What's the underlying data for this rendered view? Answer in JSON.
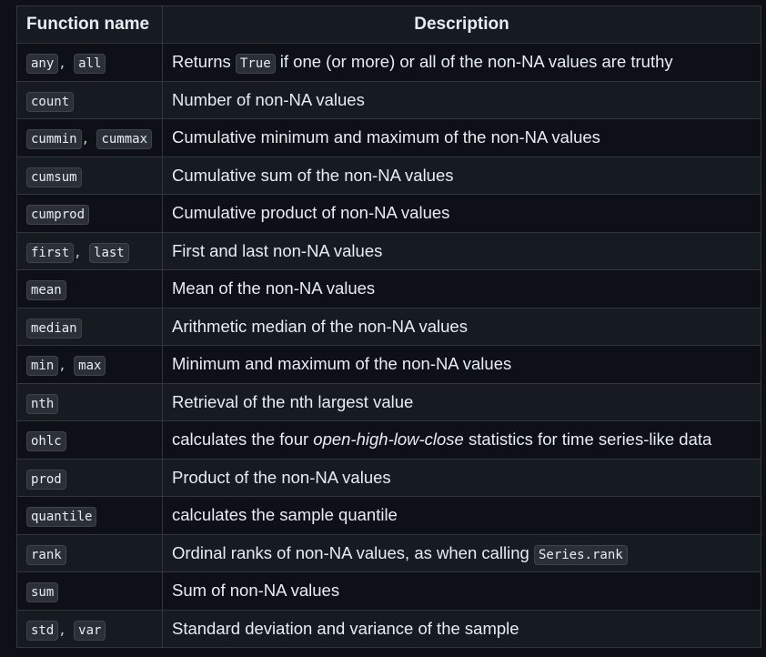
{
  "headers": [
    "Function name",
    "Description"
  ],
  "rows": [
    {
      "names": [
        "any",
        "all"
      ],
      "desc": [
        {
          "t": "text",
          "v": "Returns "
        },
        {
          "t": "code",
          "v": "True"
        },
        {
          "t": "text",
          "v": " if one (or more) or all of the non-NA values are truthy"
        }
      ]
    },
    {
      "names": [
        "count"
      ],
      "desc": [
        {
          "t": "text",
          "v": "Number of non-NA values"
        }
      ]
    },
    {
      "names": [
        "cummin",
        "cummax"
      ],
      "desc": [
        {
          "t": "text",
          "v": "Cumulative minimum and maximum of the non-NA values"
        }
      ]
    },
    {
      "names": [
        "cumsum"
      ],
      "desc": [
        {
          "t": "text",
          "v": "Cumulative sum of the non-NA values"
        }
      ]
    },
    {
      "names": [
        "cumprod"
      ],
      "desc": [
        {
          "t": "text",
          "v": "Cumulative product of non-NA values"
        }
      ]
    },
    {
      "names": [
        "first",
        "last"
      ],
      "desc": [
        {
          "t": "text",
          "v": "First and last non-NA values"
        }
      ]
    },
    {
      "names": [
        "mean"
      ],
      "desc": [
        {
          "t": "text",
          "v": "Mean of the non-NA values"
        }
      ]
    },
    {
      "names": [
        "median"
      ],
      "desc": [
        {
          "t": "text",
          "v": "Arithmetic median of the non-NA values"
        }
      ]
    },
    {
      "names": [
        "min",
        "max"
      ],
      "desc": [
        {
          "t": "text",
          "v": "Minimum and maximum of the non-NA values"
        }
      ]
    },
    {
      "names": [
        "nth"
      ],
      "desc": [
        {
          "t": "text",
          "v": "Retrieval of the nth largest value"
        }
      ]
    },
    {
      "names": [
        "ohlc"
      ],
      "desc": [
        {
          "t": "text",
          "v": "calculates the four "
        },
        {
          "t": "em",
          "v": "open-high-low-close"
        },
        {
          "t": "text",
          "v": " statistics for time series-like data"
        }
      ]
    },
    {
      "names": [
        "prod"
      ],
      "desc": [
        {
          "t": "text",
          "v": "Product of the non-NA values"
        }
      ]
    },
    {
      "names": [
        "quantile"
      ],
      "desc": [
        {
          "t": "text",
          "v": "calculates the sample quantile"
        }
      ]
    },
    {
      "names": [
        "rank"
      ],
      "desc": [
        {
          "t": "text",
          "v": "Ordinal ranks of non-NA values, as when calling "
        },
        {
          "t": "code",
          "v": "Series.rank"
        }
      ]
    },
    {
      "names": [
        "sum"
      ],
      "desc": [
        {
          "t": "text",
          "v": "Sum of non-NA values"
        }
      ]
    },
    {
      "names": [
        "std",
        "var"
      ],
      "desc": [
        {
          "t": "text",
          "v": "Standard deviation and variance of the sample"
        }
      ]
    }
  ]
}
